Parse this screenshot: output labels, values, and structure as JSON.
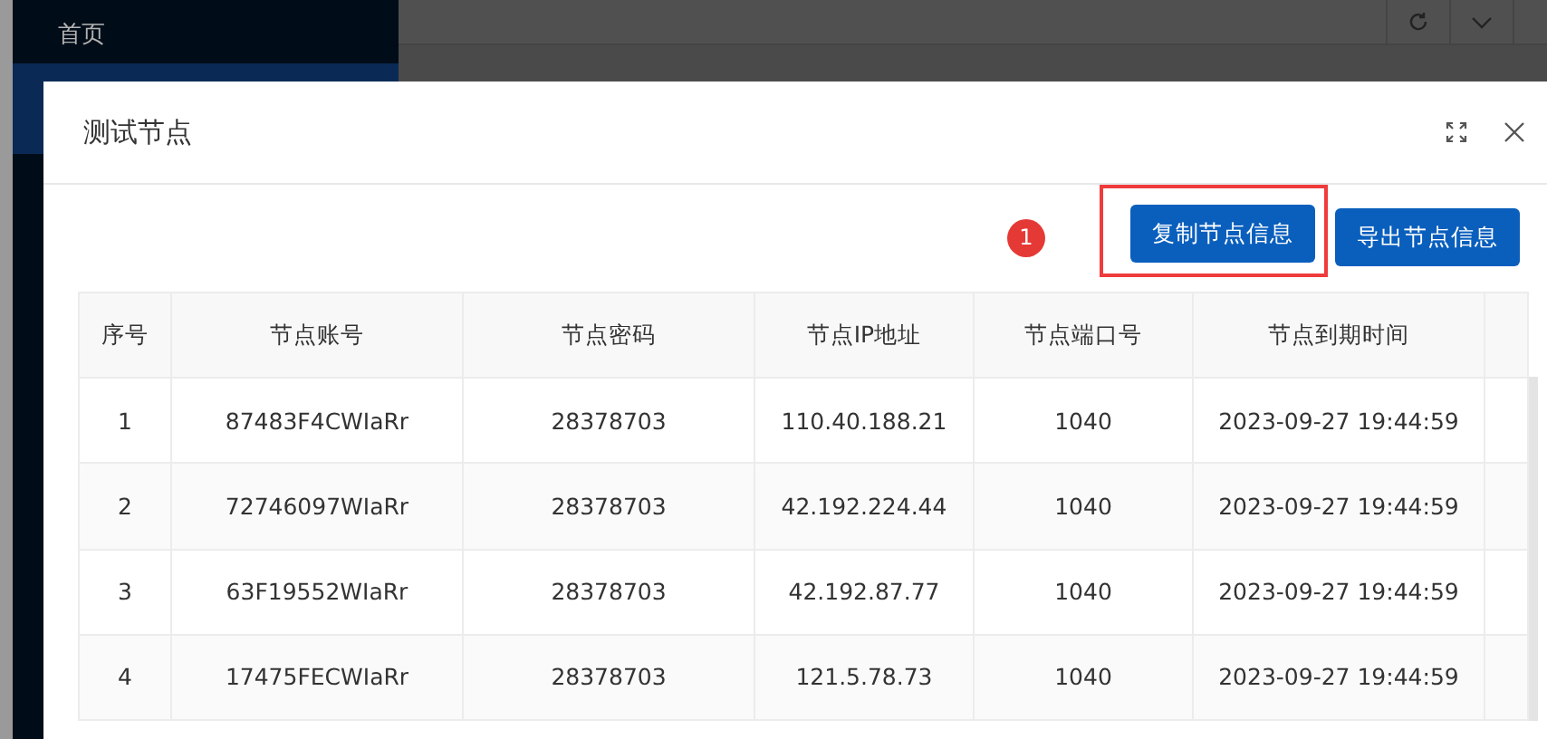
{
  "sidebar": {
    "items": [
      {
        "label": "首页"
      }
    ]
  },
  "dialog": {
    "title": "测试节点",
    "annotation": {
      "badge": "1"
    },
    "buttons": [
      {
        "label": "复制节点信息",
        "highlighted": true
      },
      {
        "label": "导出节点信息",
        "highlighted": false
      }
    ],
    "table": {
      "columns": [
        "序号",
        "节点账号",
        "节点密码",
        "节点IP地址",
        "节点端口号",
        "节点到期时间"
      ],
      "rows": [
        [
          "1",
          "87483F4CWIaRr",
          "28378703",
          "110.40.188.21",
          "1040",
          "2023-09-27 19:44:59"
        ],
        [
          "2",
          "72746097WIaRr",
          "28378703",
          "42.192.224.44",
          "1040",
          "2023-09-27 19:44:59"
        ],
        [
          "3",
          "63F19552WIaRr",
          "28378703",
          "42.192.87.77",
          "1040",
          "2023-09-27 19:44:59"
        ],
        [
          "4",
          "17475FECWIaRr",
          "28378703",
          "121.5.78.73",
          "1040",
          "2023-09-27 19:44:59"
        ]
      ]
    }
  }
}
